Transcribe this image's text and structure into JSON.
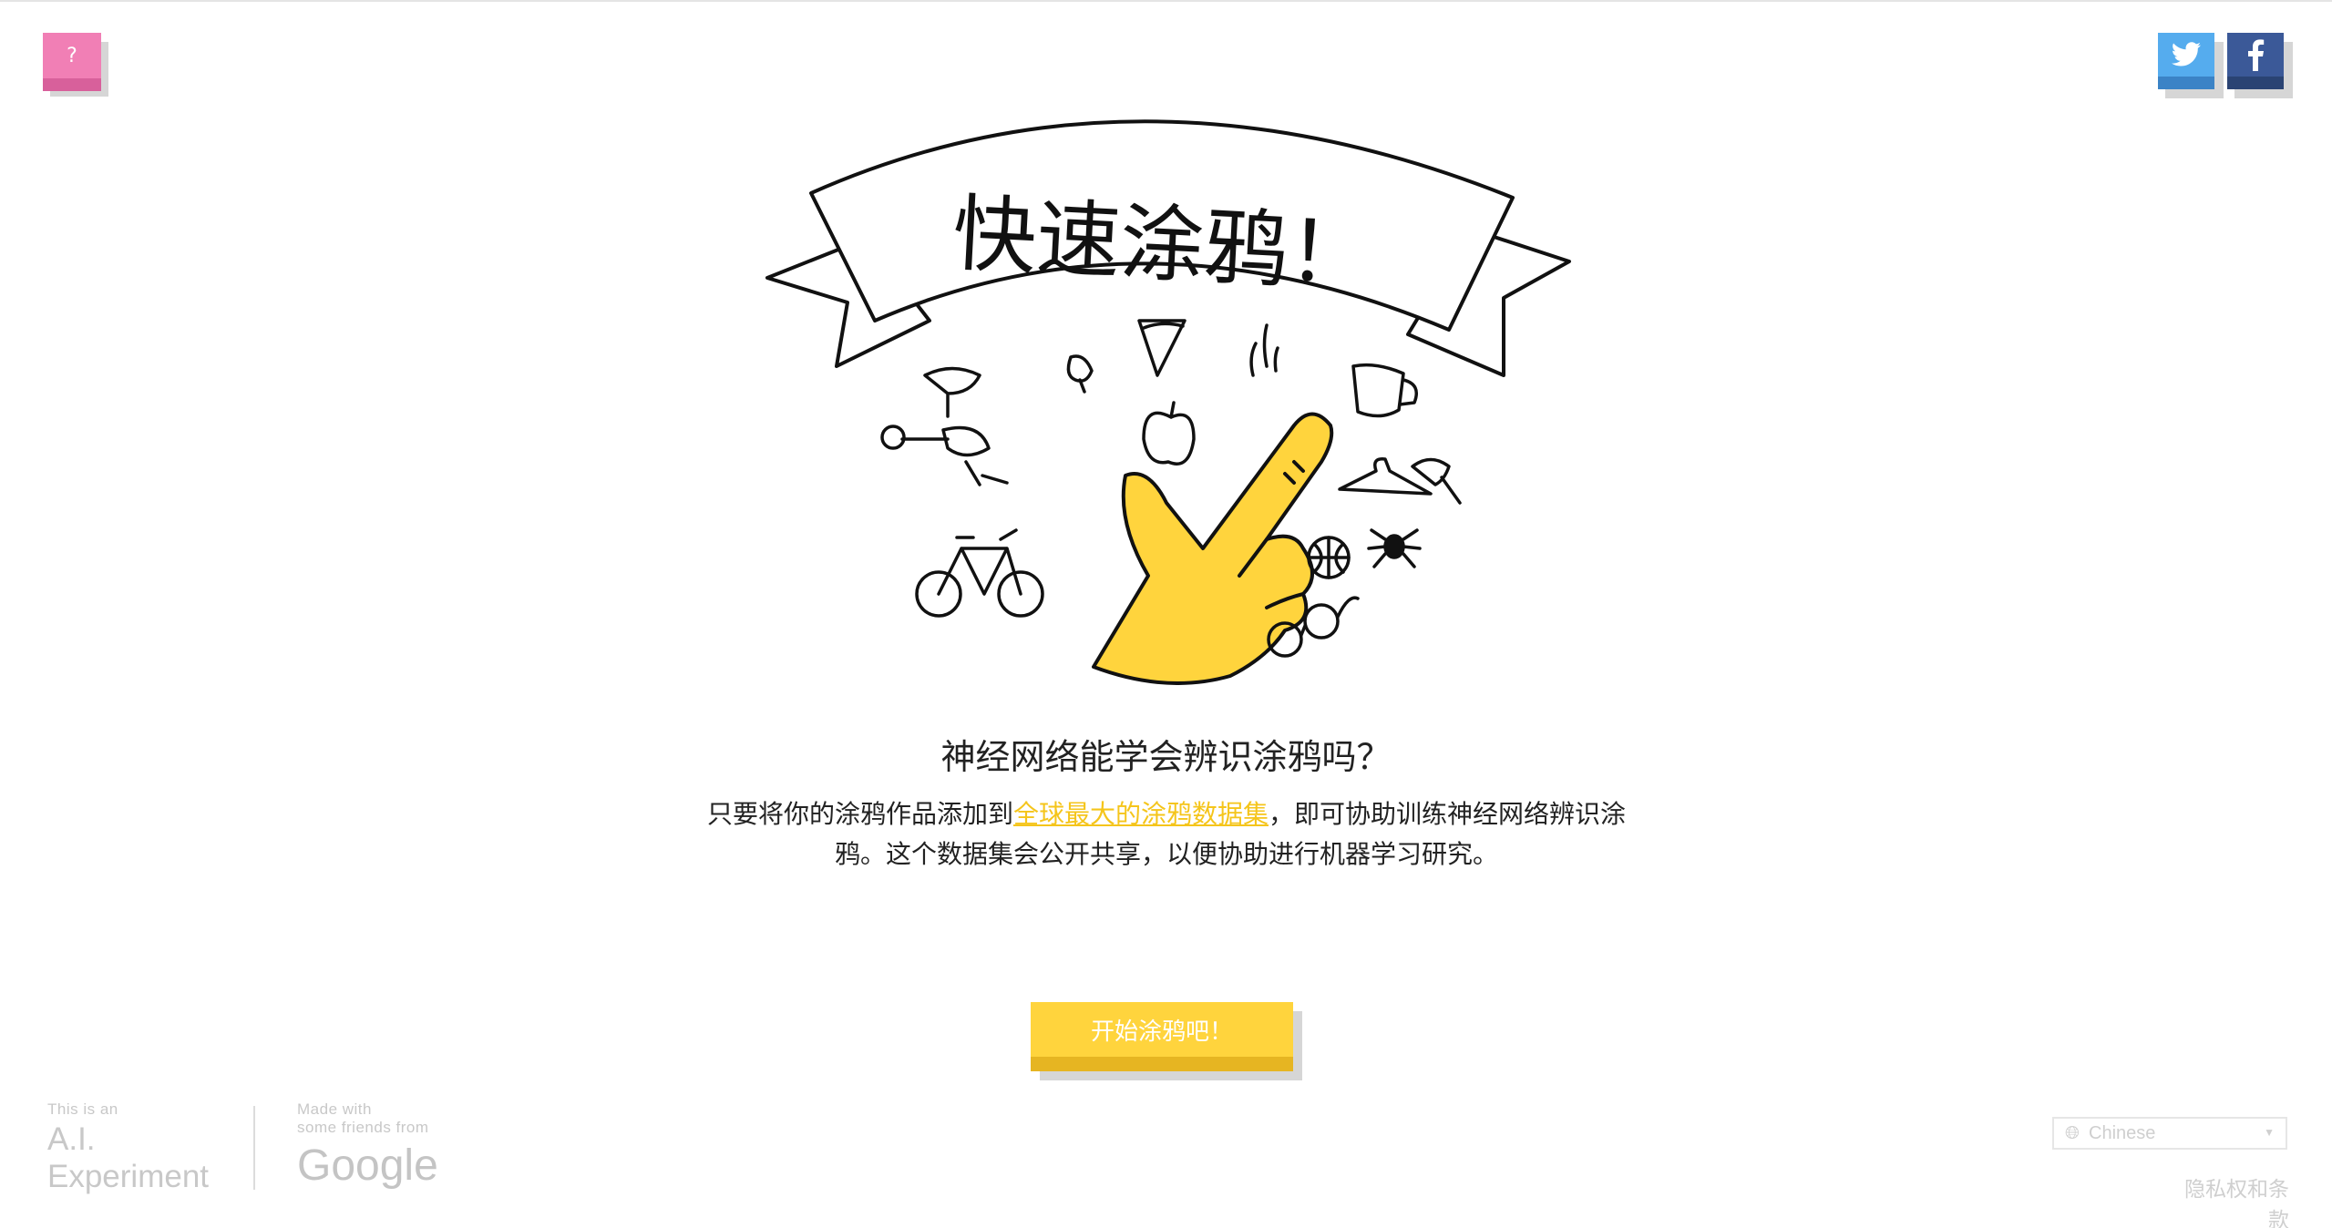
{
  "header": {
    "help_label": "?",
    "twitter_icon": "twitter-bird-icon",
    "facebook_icon": "facebook-f-icon"
  },
  "hero": {
    "banner_title": "快速涂鸦！"
  },
  "main": {
    "headline": "神经网络能学会辨识涂鸦吗？",
    "description_before": "只要将你的涂鸦作品添加到",
    "dataset_link": "全球最大的涂鸦数据集",
    "description_after": "，即可协助训练神经网络辨识涂鸦。这个数据集会公开共享，以便协助进行机器学习研究。",
    "start_button": "开始涂鸦吧！"
  },
  "footer": {
    "ai_small": "This is an",
    "ai_line1": "A.I.",
    "ai_line2": "Experiment",
    "made_line1": "Made with",
    "made_line2": "some friends from",
    "google": "Google",
    "language": "Chinese",
    "privacy": "隐私权和条款"
  },
  "colors": {
    "help": "#f17fb5",
    "twitter": "#55acee",
    "facebook": "#3b5998",
    "accent_yellow": "#ffd43d"
  }
}
